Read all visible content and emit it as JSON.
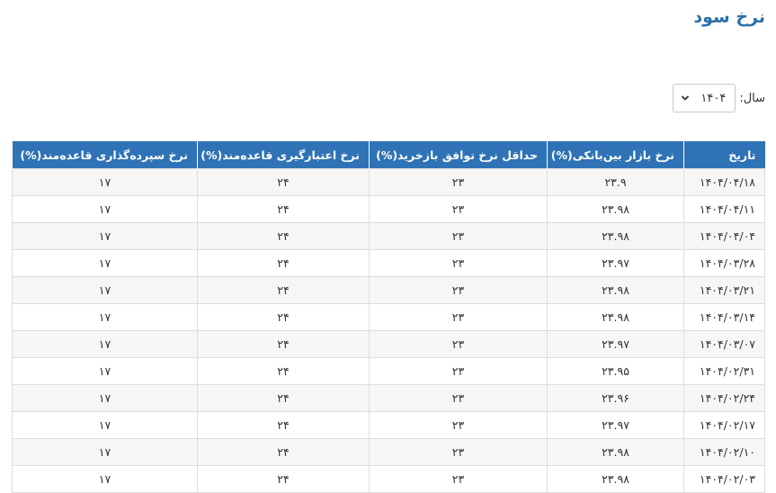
{
  "page": {
    "title": "نرخ سود"
  },
  "filter": {
    "year_label": "سال:",
    "year_value": "۱۴۰۴"
  },
  "table": {
    "headers": {
      "date": "تاریخ",
      "interbank": "نرخ بازار بین‌بانکی(%)",
      "min_repo": "حداقل نرخ توافق بازخرید(%)",
      "credit": "نرخ اعتبارگیری قاعده‌مند(%)",
      "deposit": "نرخ سپرده‌گذاری قاعده‌مند(%)"
    },
    "rows": [
      {
        "date": "۱۴۰۴/۰۴/۱۸",
        "interbank": "۲۳.۹",
        "min_repo": "۲۳",
        "credit": "۲۴",
        "deposit": "۱۷"
      },
      {
        "date": "۱۴۰۴/۰۴/۱۱",
        "interbank": "۲۳.۹۸",
        "min_repo": "۲۳",
        "credit": "۲۴",
        "deposit": "۱۷"
      },
      {
        "date": "۱۴۰۴/۰۴/۰۴",
        "interbank": "۲۳.۹۸",
        "min_repo": "۲۳",
        "credit": "۲۴",
        "deposit": "۱۷"
      },
      {
        "date": "۱۴۰۴/۰۳/۲۸",
        "interbank": "۲۳.۹۷",
        "min_repo": "۲۳",
        "credit": "۲۴",
        "deposit": "۱۷"
      },
      {
        "date": "۱۴۰۴/۰۳/۲۱",
        "interbank": "۲۳.۹۸",
        "min_repo": "۲۳",
        "credit": "۲۴",
        "deposit": "۱۷"
      },
      {
        "date": "۱۴۰۴/۰۳/۱۴",
        "interbank": "۲۳.۹۸",
        "min_repo": "۲۳",
        "credit": "۲۴",
        "deposit": "۱۷"
      },
      {
        "date": "۱۴۰۴/۰۳/۰۷",
        "interbank": "۲۳.۹۷",
        "min_repo": "۲۳",
        "credit": "۲۴",
        "deposit": "۱۷"
      },
      {
        "date": "۱۴۰۴/۰۲/۳۱",
        "interbank": "۲۳.۹۵",
        "min_repo": "۲۳",
        "credit": "۲۴",
        "deposit": "۱۷"
      },
      {
        "date": "۱۴۰۴/۰۲/۲۴",
        "interbank": "۲۳.۹۶",
        "min_repo": "۲۳",
        "credit": "۲۴",
        "deposit": "۱۷"
      },
      {
        "date": "۱۴۰۴/۰۲/۱۷",
        "interbank": "۲۳.۹۷",
        "min_repo": "۲۳",
        "credit": "۲۴",
        "deposit": "۱۷"
      },
      {
        "date": "۱۴۰۴/۰۲/۱۰",
        "interbank": "۲۳.۹۸",
        "min_repo": "۲۳",
        "credit": "۲۴",
        "deposit": "۱۷"
      },
      {
        "date": "۱۴۰۴/۰۲/۰۳",
        "interbank": "۲۳.۹۸",
        "min_repo": "۲۳",
        "credit": "۲۴",
        "deposit": "۱۷"
      }
    ]
  },
  "colors": {
    "title": "#2a6fa8",
    "header_bg": "#2f73b6",
    "header_text": "#ffffff",
    "row_alt": "#f6f6f6"
  }
}
